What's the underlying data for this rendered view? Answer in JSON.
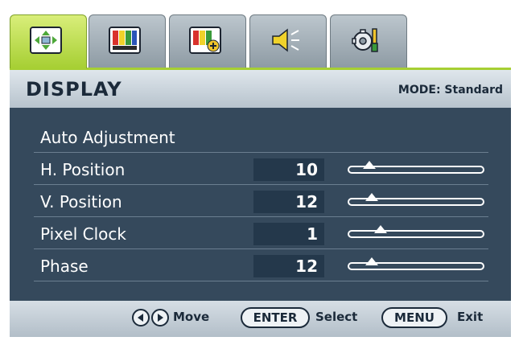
{
  "tabs": [
    {
      "icon": "display-arrows-icon",
      "active": true
    },
    {
      "icon": "picture-color-bars-icon",
      "active": false
    },
    {
      "icon": "picture-advanced-icon",
      "active": false
    },
    {
      "icon": "speaker-audio-icon",
      "active": false
    },
    {
      "icon": "system-settings-gear-icon",
      "active": false
    }
  ],
  "header": {
    "title": "DISPLAY",
    "mode_label": "MODE: Standard"
  },
  "menu": {
    "items": [
      {
        "label": "Auto Adjustment"
      },
      {
        "label": "H. Position",
        "value": "10",
        "level": 0.1
      },
      {
        "label": "V. Position",
        "value": "12",
        "level": 0.12
      },
      {
        "label": "Pixel Clock",
        "value": "1",
        "level": 0.2
      },
      {
        "label": "Phase",
        "value": "12",
        "level": 0.12
      }
    ]
  },
  "footer": {
    "move_label": "Move",
    "enter_key": "ENTER",
    "select_label": "Select",
    "menu_key": "MENU",
    "exit_label": "Exit"
  },
  "colors": {
    "active_tab": "#a6cf33",
    "menu_bg": "#35495c",
    "value_bg": "#24384b",
    "text_dark": "#1b2a3a"
  }
}
